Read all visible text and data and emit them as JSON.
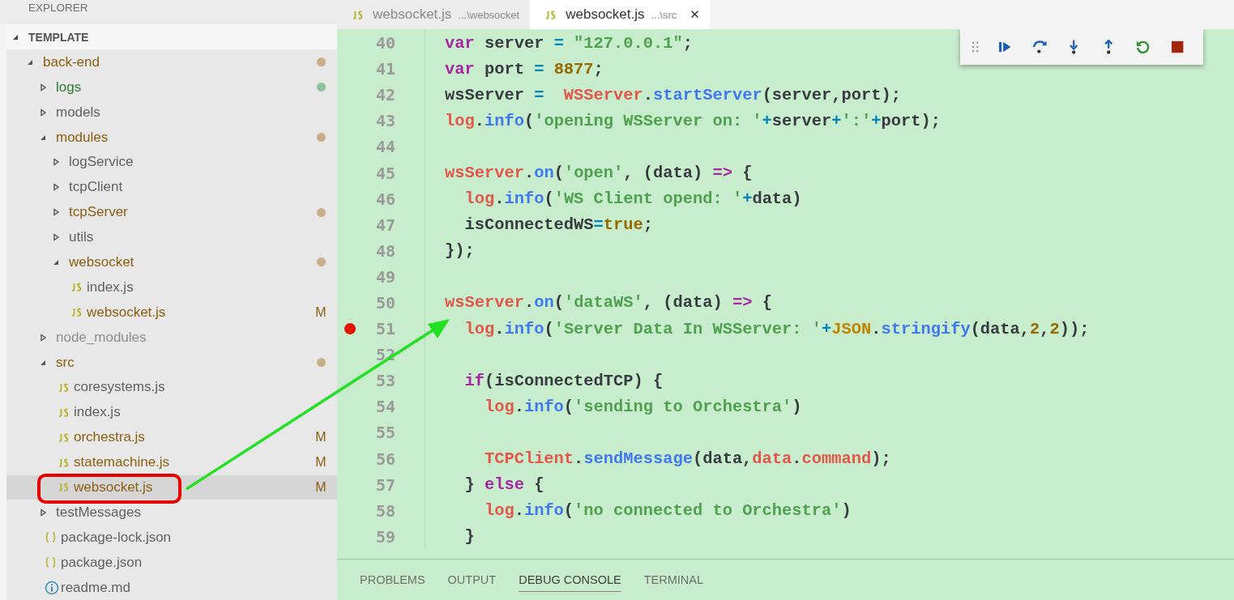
{
  "sidebar": {
    "title": "EXPLORER",
    "section": {
      "label": "TEMPLATE"
    },
    "tree": [
      {
        "label": "back-end",
        "kind": "folder",
        "expanded": true,
        "modified": true,
        "untracked": false,
        "ignored": false,
        "color": "#c9ae88",
        "selected": false,
        "children": [
          {
            "label": "logs",
            "kind": "folder",
            "expanded": false,
            "modified": false,
            "untracked": true,
            "ignored": false,
            "color": "#8fc49a",
            "selected": false
          },
          {
            "label": "models",
            "kind": "folder",
            "expanded": false,
            "modified": false,
            "untracked": false,
            "ignored": false,
            "selected": false
          },
          {
            "label": "modules",
            "kind": "folder",
            "expanded": true,
            "modified": true,
            "untracked": false,
            "ignored": false,
            "color": "#c9ae88",
            "selected": false,
            "children": [
              {
                "label": "logService",
                "kind": "folder",
                "expanded": false,
                "modified": false,
                "untracked": false,
                "ignored": false,
                "selected": false
              },
              {
                "label": "tcpClient",
                "kind": "folder",
                "expanded": false,
                "modified": false,
                "untracked": false,
                "ignored": false,
                "selected": false
              },
              {
                "label": "tcpServer",
                "kind": "folder",
                "expanded": false,
                "modified": true,
                "untracked": false,
                "ignored": false,
                "color": "#c9ae88",
                "selected": false
              },
              {
                "label": "utils",
                "kind": "folder",
                "expanded": false,
                "modified": false,
                "untracked": false,
                "ignored": false,
                "selected": false
              },
              {
                "label": "websocket",
                "kind": "folder",
                "expanded": true,
                "modified": true,
                "untracked": false,
                "ignored": false,
                "color": "#c9ae88",
                "selected": false,
                "children": [
                  {
                    "label": "index.js",
                    "kind": "js",
                    "modified": false,
                    "untracked": false,
                    "ignored": false,
                    "selected": false
                  },
                  {
                    "label": "websocket.js",
                    "kind": "js",
                    "modified": true,
                    "untracked": false,
                    "ignored": false,
                    "badge": "M",
                    "selected": false
                  }
                ]
              }
            ]
          },
          {
            "label": "node_modules",
            "kind": "folder",
            "expanded": false,
            "modified": false,
            "untracked": false,
            "ignored": true,
            "selected": false
          },
          {
            "label": "src",
            "kind": "folder",
            "expanded": true,
            "modified": true,
            "untracked": false,
            "ignored": false,
            "color": "#c9ae88",
            "selected": false,
            "children": [
              {
                "label": "coresystems.js",
                "kind": "js",
                "modified": false,
                "untracked": false,
                "ignored": false,
                "selected": false
              },
              {
                "label": "index.js",
                "kind": "js",
                "modified": false,
                "untracked": false,
                "ignored": false,
                "selected": false
              },
              {
                "label": "orchestra.js",
                "kind": "js",
                "modified": true,
                "untracked": false,
                "ignored": false,
                "badge": "M",
                "selected": false
              },
              {
                "label": "statemachine.js",
                "kind": "js",
                "modified": true,
                "untracked": false,
                "ignored": false,
                "badge": "M",
                "selected": false
              },
              {
                "label": "websocket.js",
                "kind": "js",
                "modified": true,
                "untracked": false,
                "ignored": false,
                "badge": "M",
                "selected": true
              }
            ]
          },
          {
            "label": "testMessages",
            "kind": "folder",
            "expanded": false,
            "modified": false,
            "untracked": false,
            "ignored": false,
            "selected": false
          },
          {
            "label": "package-lock.json",
            "kind": "json",
            "modified": false,
            "untracked": false,
            "ignored": false,
            "selected": false
          },
          {
            "label": "package.json",
            "kind": "json",
            "modified": false,
            "untracked": false,
            "ignored": false,
            "selected": false
          },
          {
            "label": "readme.md",
            "kind": "info",
            "modified": false,
            "untracked": false,
            "ignored": false,
            "selected": false
          }
        ]
      }
    ]
  },
  "tabs": [
    {
      "label": "websocket.js",
      "description": "...\\websocket",
      "selected": false
    },
    {
      "label": "websocket.js",
      "description": "...\\src",
      "selected": true,
      "close": "✕"
    }
  ],
  "debug_toolbar": [
    {
      "kind": "grip"
    },
    {
      "kind": "continue"
    },
    {
      "kind": "step-over"
    },
    {
      "kind": "step-into"
    },
    {
      "kind": "step-out"
    },
    {
      "kind": "restart"
    },
    {
      "kind": "stop"
    }
  ],
  "editor": {
    "lines": [
      {
        "number": "40",
        "tokens": [
          {
            "kind": "keyword",
            "text": "var"
          },
          {
            "kind": "plain",
            "text": " server "
          },
          {
            "kind": "operator",
            "text": "="
          },
          {
            "kind": "string",
            "text": " \"127.0.0.1\""
          },
          {
            "kind": "plain",
            "text": ";"
          }
        ]
      },
      {
        "number": "41",
        "tokens": [
          {
            "kind": "keyword",
            "text": "var"
          },
          {
            "kind": "plain",
            "text": " port "
          },
          {
            "kind": "operator",
            "text": "="
          },
          {
            "kind": "number",
            "text": " 8877"
          },
          {
            "kind": "plain",
            "text": ";"
          }
        ]
      },
      {
        "number": "42",
        "tokens": [
          {
            "kind": "plain",
            "text": "wsServer "
          },
          {
            "kind": "operator",
            "text": "="
          },
          {
            "kind": "variable",
            "text": "  WSServer"
          },
          {
            "kind": "plain",
            "text": "."
          },
          {
            "kind": "function",
            "text": "startServer"
          },
          {
            "kind": "plain",
            "text": "(server,port);"
          }
        ]
      },
      {
        "number": "43",
        "tokens": [
          {
            "kind": "variable",
            "text": "log"
          },
          {
            "kind": "plain",
            "text": "."
          },
          {
            "kind": "function",
            "text": "info"
          },
          {
            "kind": "plain",
            "text": "("
          },
          {
            "kind": "string",
            "text": "'opening WSServer on: '"
          },
          {
            "kind": "operator",
            "text": "+"
          },
          {
            "kind": "plain",
            "text": "server"
          },
          {
            "kind": "operator",
            "text": "+"
          },
          {
            "kind": "string",
            "text": "':'"
          },
          {
            "kind": "operator",
            "text": "+"
          },
          {
            "kind": "plain",
            "text": "port);"
          }
        ]
      },
      {
        "number": "44"
      },
      {
        "number": "45",
        "tokens": [
          {
            "kind": "variable",
            "text": "wsServer"
          },
          {
            "kind": "plain",
            "text": "."
          },
          {
            "kind": "function",
            "text": "on"
          },
          {
            "kind": "plain",
            "text": "("
          },
          {
            "kind": "string",
            "text": "'open'"
          },
          {
            "kind": "plain",
            "text": ", (data) "
          },
          {
            "kind": "keyword",
            "text": "=>"
          },
          {
            "kind": "plain",
            "text": " {"
          }
        ]
      },
      {
        "number": "46",
        "tokens": [
          {
            "kind": "variable",
            "text": "  log"
          },
          {
            "kind": "plain",
            "text": "."
          },
          {
            "kind": "function",
            "text": "info"
          },
          {
            "kind": "plain",
            "text": "("
          },
          {
            "kind": "string",
            "text": "'WS Client opend: '"
          },
          {
            "kind": "operator",
            "text": "+"
          },
          {
            "kind": "plain",
            "text": "data)"
          }
        ]
      },
      {
        "number": "47",
        "tokens": [
          {
            "kind": "plain",
            "text": "  isConnectedWS"
          },
          {
            "kind": "operator",
            "text": "="
          },
          {
            "kind": "number",
            "text": "true"
          },
          {
            "kind": "plain",
            "text": ";"
          }
        ]
      },
      {
        "number": "48",
        "tokens": [
          {
            "kind": "plain",
            "text": "});"
          }
        ]
      },
      {
        "number": "49"
      },
      {
        "number": "50",
        "tokens": [
          {
            "kind": "variable",
            "text": "wsServer"
          },
          {
            "kind": "plain",
            "text": "."
          },
          {
            "kind": "function",
            "text": "on"
          },
          {
            "kind": "plain",
            "text": "("
          },
          {
            "kind": "string",
            "text": "'dataWS'"
          },
          {
            "kind": "plain",
            "text": ", (data) "
          },
          {
            "kind": "keyword",
            "text": "=>"
          },
          {
            "kind": "plain",
            "text": " {"
          }
        ]
      },
      {
        "number": "51",
        "breakpoint": true,
        "tokens": [
          {
            "kind": "variable",
            "text": "  log"
          },
          {
            "kind": "plain",
            "text": "."
          },
          {
            "kind": "function",
            "text": "info"
          },
          {
            "kind": "plain",
            "text": "("
          },
          {
            "kind": "string",
            "text": "'Server Data In WSServer: '"
          },
          {
            "kind": "operator",
            "text": "+"
          },
          {
            "kind": "type",
            "text": "JSON"
          },
          {
            "kind": "plain",
            "text": "."
          },
          {
            "kind": "function",
            "text": "stringify"
          },
          {
            "kind": "plain",
            "text": "(data,"
          },
          {
            "kind": "number",
            "text": "2"
          },
          {
            "kind": "plain",
            "text": ","
          },
          {
            "kind": "number",
            "text": "2"
          },
          {
            "kind": "plain",
            "text": "));"
          }
        ]
      },
      {
        "number": "52"
      },
      {
        "number": "53",
        "tokens": [
          {
            "kind": "keyword",
            "text": "  if"
          },
          {
            "kind": "plain",
            "text": "(isConnectedTCP) {"
          }
        ]
      },
      {
        "number": "54",
        "tokens": [
          {
            "kind": "variable",
            "text": "    log"
          },
          {
            "kind": "plain",
            "text": "."
          },
          {
            "kind": "function",
            "text": "info"
          },
          {
            "kind": "plain",
            "text": "("
          },
          {
            "kind": "string",
            "text": "'sending to Orchestra'"
          },
          {
            "kind": "plain",
            "text": ")"
          }
        ]
      },
      {
        "number": "55"
      },
      {
        "number": "56",
        "tokens": [
          {
            "kind": "variable",
            "text": "    TCPClient"
          },
          {
            "kind": "plain",
            "text": "."
          },
          {
            "kind": "function",
            "text": "sendMessage"
          },
          {
            "kind": "plain",
            "text": "(data,"
          },
          {
            "kind": "variable",
            "text": "data"
          },
          {
            "kind": "plain",
            "text": "."
          },
          {
            "kind": "variable",
            "text": "command"
          },
          {
            "kind": "plain",
            "text": ");"
          }
        ]
      },
      {
        "number": "57",
        "tokens": [
          {
            "kind": "plain",
            "text": "  } "
          },
          {
            "kind": "keyword",
            "text": "else"
          },
          {
            "kind": "plain",
            "text": " {"
          }
        ]
      },
      {
        "number": "58",
        "tokens": [
          {
            "kind": "variable",
            "text": "    log"
          },
          {
            "kind": "plain",
            "text": "."
          },
          {
            "kind": "function",
            "text": "info"
          },
          {
            "kind": "plain",
            "text": "("
          },
          {
            "kind": "string",
            "text": "'no connected to Orchestra'"
          },
          {
            "kind": "plain",
            "text": ")"
          }
        ]
      },
      {
        "number": "59",
        "tokens": [
          {
            "kind": "plain",
            "text": "  }"
          }
        ]
      }
    ]
  },
  "panel": {
    "tabs": [
      {
        "label": "PROBLEMS",
        "selected": false
      },
      {
        "label": "OUTPUT",
        "selected": false
      },
      {
        "label": "DEBUG CONSOLE",
        "selected": true
      },
      {
        "label": "TERMINAL",
        "selected": false
      }
    ]
  }
}
